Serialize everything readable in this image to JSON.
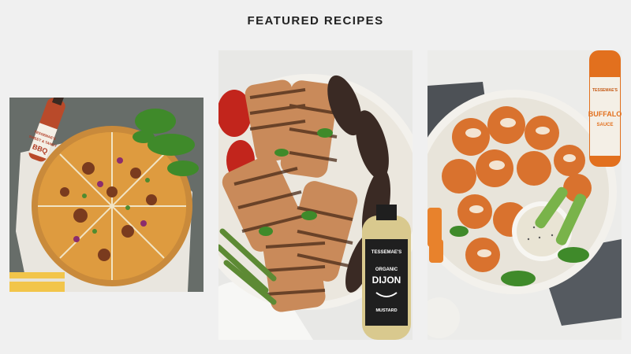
{
  "section": {
    "title": "FEATURED RECIPES"
  },
  "recipes": [
    {
      "alt_icon": "bbq-pizza-photo",
      "bottle_brand": "TESSEMAE'S",
      "bottle_label_line1": "SWEET & TANGY",
      "bottle_label_line2": "BBQ"
    },
    {
      "alt_icon": "grilled-chicken-platter-photo",
      "bottle_brand": "TESSEMAE'S",
      "bottle_label_line1": "ORGANIC",
      "bottle_label_line2": "DIJON",
      "bottle_label_line3": "MUSTARD"
    },
    {
      "alt_icon": "buffalo-cauliflower-bites-photo",
      "bottle_brand": "TESSEMAE'S",
      "bottle_label_line1": "BUFFALO",
      "bottle_label_line2": "SAUCE"
    }
  ]
}
